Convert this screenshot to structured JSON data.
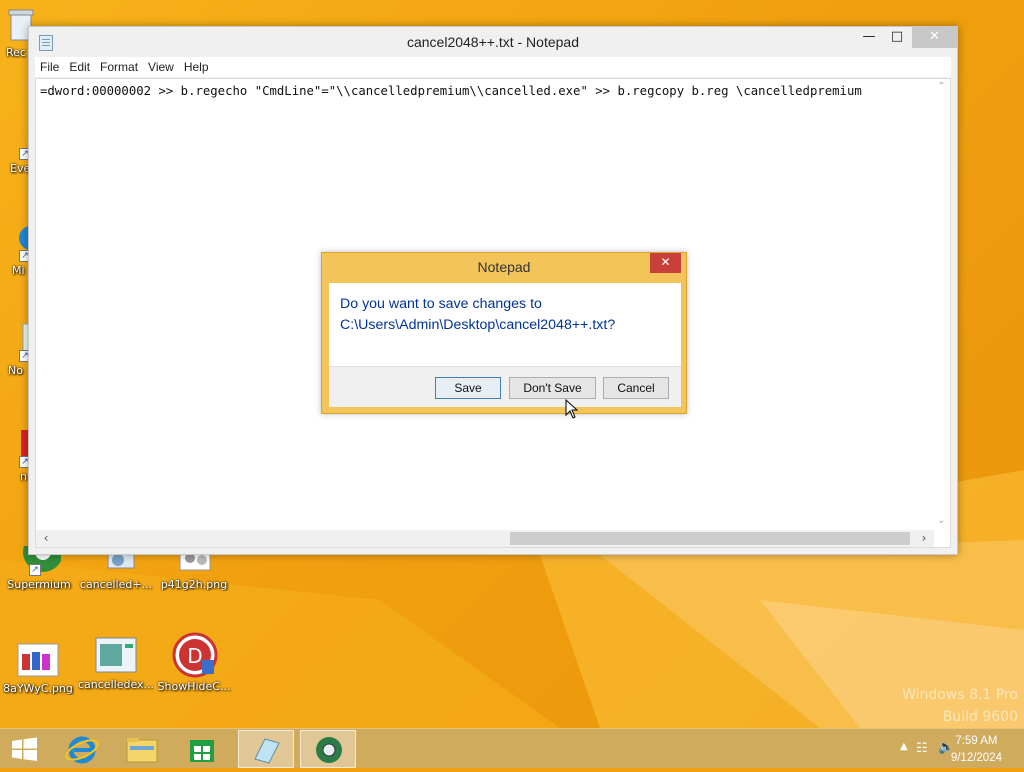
{
  "notepad": {
    "title": "cancel2048++.txt - Notepad",
    "menu": [
      "File",
      "Edit",
      "Format",
      "View",
      "Help"
    ],
    "content": "=dword:00000002 >> b.regecho \"CmdLine\"=\"\\\\cancelledpremium\\\\cancelled.exe\" >> b.regcopy b.reg \\cancelledpremium"
  },
  "dialog": {
    "title": "Notepad",
    "message_line1": "Do you want to save changes to",
    "message_line2": "C:\\Users\\Admin\\Desktop\\cancel2048++.txt?",
    "save_label": "Save",
    "dont_save_label": "Don't Save",
    "cancel_label": "Cancel"
  },
  "desktop": {
    "icons": [
      {
        "label": "Rec",
        "icon": "recycle-bin-icon"
      },
      {
        "label": "Eve",
        "icon": "app-shortcut-icon"
      },
      {
        "label": "Mi",
        "icon": "app-shortcut-icon"
      },
      {
        "label": "No",
        "icon": "app-shortcut-icon"
      },
      {
        "label": "n",
        "icon": "app-shortcut-icon"
      },
      {
        "label": "Supermium",
        "icon": "browser-icon"
      },
      {
        "label": "cancelled+...",
        "icon": "script-icon"
      },
      {
        "label": "p41g2h.png",
        "icon": "image-icon"
      },
      {
        "label": "8aYWyC.png",
        "icon": "image-icon"
      },
      {
        "label": "cancelledex...",
        "icon": "exe-icon"
      },
      {
        "label": "ShowHideC...",
        "icon": "app-icon"
      }
    ],
    "watermark_line1": "Windows 8.1 Pro",
    "watermark_line2": "Build 9600"
  },
  "taskbar": {
    "items": [
      "start-button",
      "internet-explorer",
      "file-explorer",
      "store",
      "notepad",
      "supermium"
    ],
    "time": "7:59 AM",
    "date": "9/12/2024"
  },
  "colors": {
    "dialog_frame": "#f3c45a",
    "message_text": "#003399",
    "close_red": "#c9403a"
  }
}
